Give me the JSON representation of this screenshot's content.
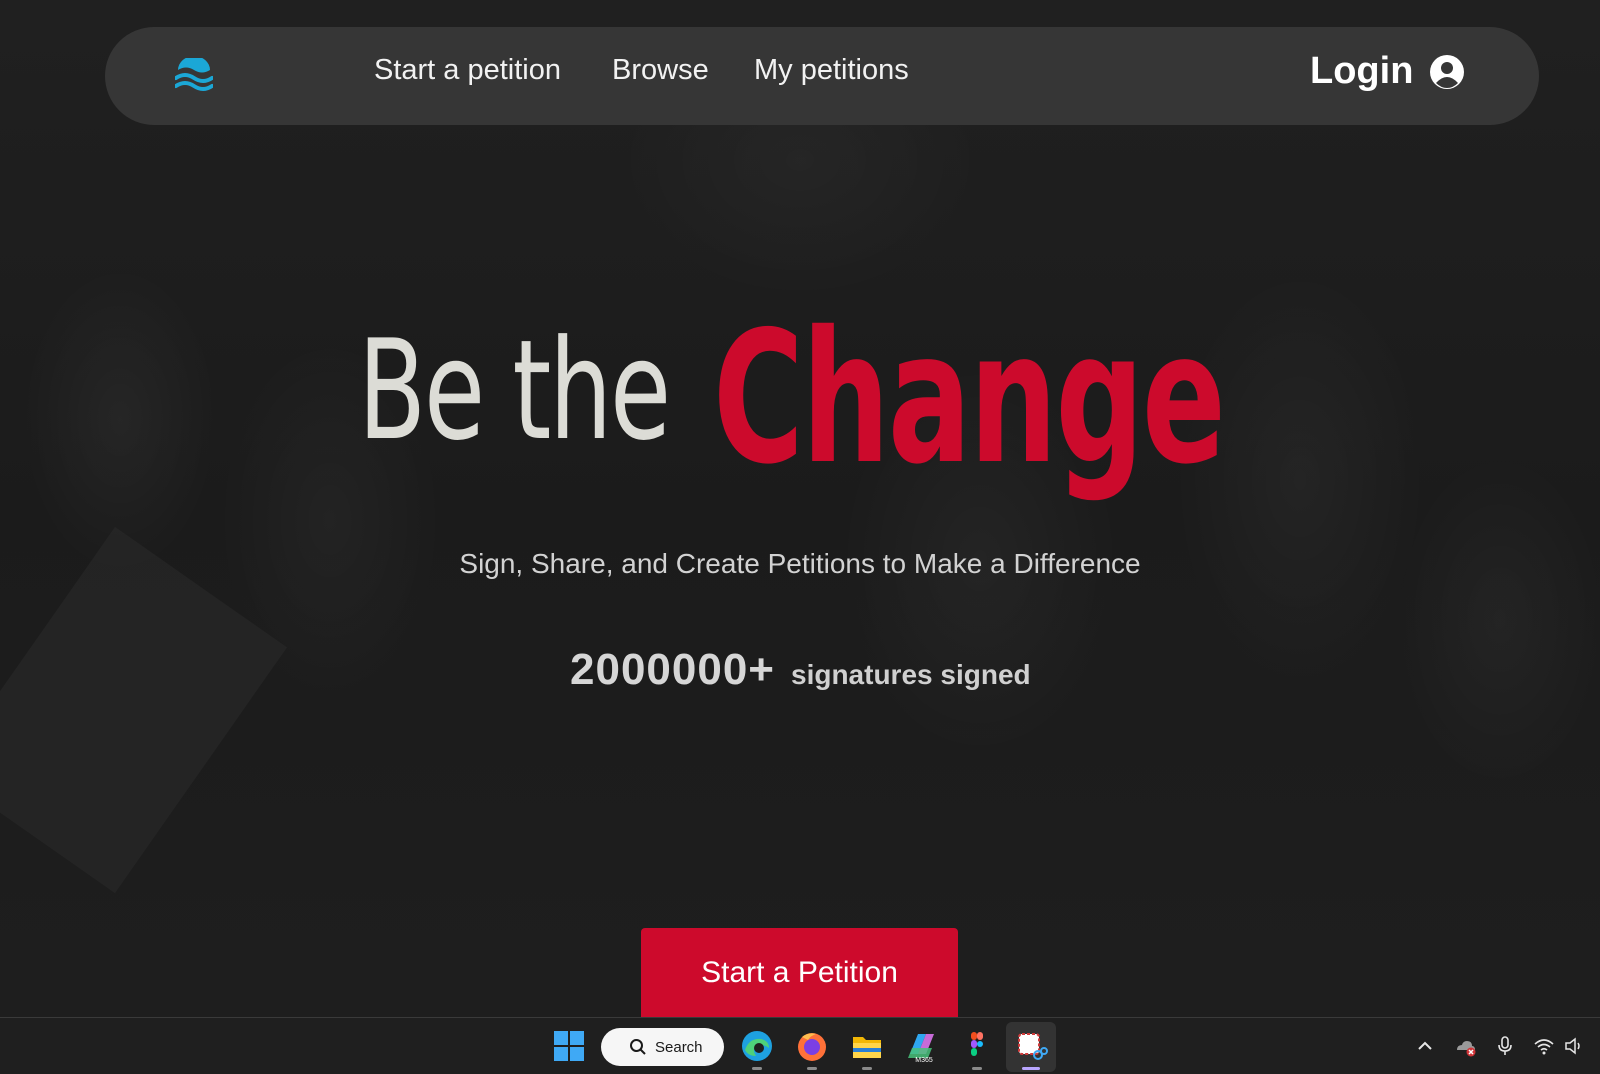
{
  "nav": {
    "links": [
      "Start a petition",
      "Browse",
      "My petitions"
    ],
    "login_label": "Login"
  },
  "hero": {
    "title_white": "Be the",
    "title_red": "Change",
    "subtitle": "Sign, Share, and Create Petitions to Make a Difference",
    "stat_number": "2000000+",
    "stat_label": "signatures signed",
    "cta_label": "Start a Petition"
  },
  "colors": {
    "accent_red": "#cc0a2c",
    "logo_blue": "#1ba7d6",
    "nav_bg": "#363636",
    "page_bg": "#1c1c1c"
  },
  "taskbar": {
    "search_label": "Search",
    "apps": [
      "windows-start",
      "edge",
      "firefox",
      "file-explorer",
      "m365-copilot",
      "figma",
      "snipping-tool"
    ],
    "tray": [
      "chevron-up",
      "onedrive-error",
      "microphone",
      "wifi",
      "volume"
    ]
  }
}
